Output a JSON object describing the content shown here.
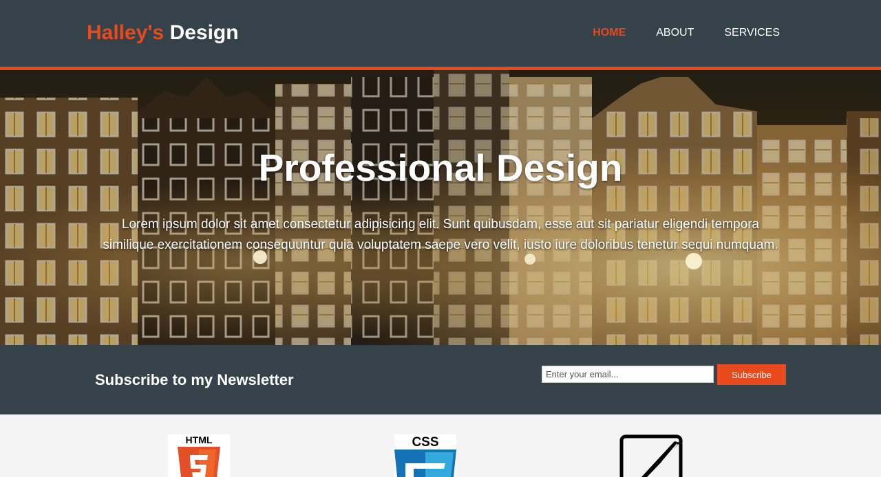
{
  "brand": {
    "highlight": "Halley's",
    "rest": "Design"
  },
  "nav": {
    "items": [
      {
        "label": "Home",
        "current": true
      },
      {
        "label": "About",
        "current": false
      },
      {
        "label": "Services",
        "current": false
      }
    ]
  },
  "showcase": {
    "title": "Professional Design",
    "text": "Lorem ipsum dolor sit amet consectetur adipisicing elit. Sunt quibusdam, esse aut sit pariatur eligendi tempora similique exercitationem consequuntur quia voluptatem saepe vero velit, iusto iure doloribus tenetur sequi numquam."
  },
  "newsletter": {
    "heading": "Subscribe to my Newsletter",
    "email_placeholder": "Enter your email...",
    "email_value": "",
    "button_label": "Subscribe"
  },
  "boxes": {
    "icons": [
      {
        "icon": "html5-icon",
        "label": "HTML"
      },
      {
        "icon": "css3-icon",
        "label": "CSS"
      },
      {
        "icon": "design-pen-icon"
      }
    ]
  },
  "colors": {
    "accent": "#e8491d",
    "header_bg": "#35424a",
    "page_bg": "#f4f4f4",
    "text_light": "#ffffff"
  }
}
